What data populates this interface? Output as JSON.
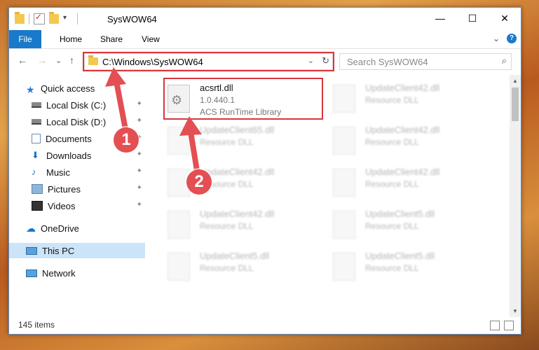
{
  "window": {
    "title": "SysWOW64",
    "controls": {
      "minimize": "—",
      "maximize": "☐",
      "close": "✕"
    }
  },
  "ribbon": {
    "tabs": [
      "File",
      "Home",
      "Share",
      "View"
    ],
    "expand": "⌄",
    "help": "?"
  },
  "nav": {
    "back": "←",
    "forward": "→",
    "recent": "⌄",
    "up": "↑",
    "address": "C:\\Windows\\SysWOW64",
    "address_drop": "⌄",
    "refresh": "↻",
    "search_placeholder": "Search SysWOW64",
    "search_icon": "⌕"
  },
  "sidebar": {
    "items": [
      {
        "label": "Quick access",
        "icon": "star-icon",
        "pinned": false
      },
      {
        "label": "Local Disk (C:)",
        "icon": "drive-icon",
        "pinned": true
      },
      {
        "label": "Local Disk (D:)",
        "icon": "drive-icon",
        "pinned": true
      },
      {
        "label": "Documents",
        "icon": "documents-icon",
        "pinned": true
      },
      {
        "label": "Downloads",
        "icon": "download-icon",
        "pinned": true
      },
      {
        "label": "Music",
        "icon": "music-icon",
        "pinned": true
      },
      {
        "label": "Pictures",
        "icon": "pictures-icon",
        "pinned": true
      },
      {
        "label": "Videos",
        "icon": "videos-icon",
        "pinned": true
      },
      {
        "label": "OneDrive",
        "icon": "cloud-icon",
        "pinned": false
      },
      {
        "label": "This PC",
        "icon": "monitor-icon",
        "pinned": false
      },
      {
        "label": "Network",
        "icon": "network-icon",
        "pinned": false
      }
    ],
    "pin_glyph": "📌"
  },
  "files": {
    "selected": {
      "name": "acsrtl.dll",
      "version": "1.0.440.1",
      "description": "ACS RunTime Library"
    },
    "others": [
      {
        "name": "UpdateClient42.dll",
        "type": "Resource DLL"
      },
      {
        "name": "UpdateClient65.dll",
        "type": "Resource DLL"
      },
      {
        "name": "UpdateClient42.dll",
        "type": "Resource DLL"
      },
      {
        "name": "UpdateClient42.dll",
        "type": "Resource DLL"
      },
      {
        "name": "UpdateClient42.dll",
        "type": "Resource DLL"
      },
      {
        "name": "UpdateClient42.dll",
        "type": "Resource DLL"
      },
      {
        "name": "UpdateClient5.dll",
        "type": "Resource DLL"
      },
      {
        "name": "UpdateClient5.dll",
        "type": "Resource DLL"
      },
      {
        "name": "UpdateClient5.dll",
        "type": "Resource DLL"
      }
    ]
  },
  "status": {
    "items_count": "145 items"
  },
  "annotations": {
    "step1": "1",
    "step2": "2"
  },
  "colors": {
    "accent": "#1979ca",
    "highlight_box": "#d9363e",
    "annotation": "#e34f53",
    "selected_nav": "#cce4f7"
  }
}
